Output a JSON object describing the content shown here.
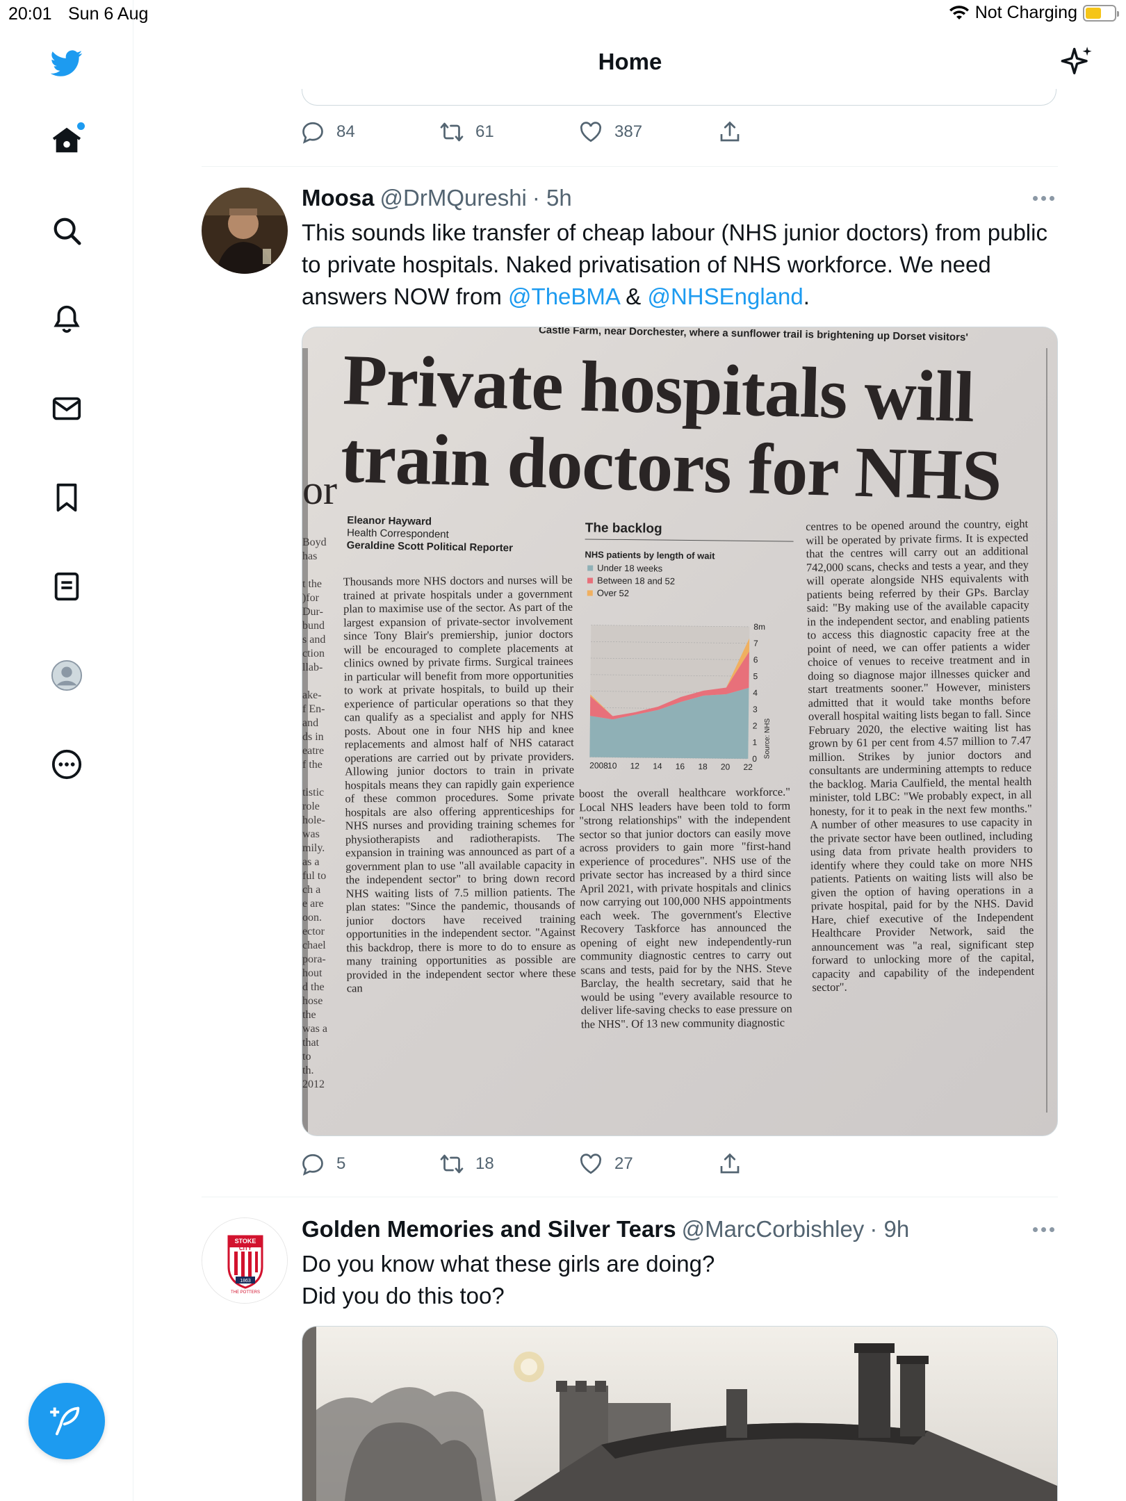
{
  "status_bar": {
    "time": "20:01",
    "date": "Sun 6 Aug",
    "charging": "Not Charging"
  },
  "header": {
    "title": "Home"
  },
  "nav": {
    "items": [
      "twitter-logo",
      "home",
      "search",
      "notifications",
      "messages",
      "bookmarks",
      "lists",
      "profile",
      "more"
    ],
    "accent_color": "#1d9bf0"
  },
  "prev_tweet": {
    "replies": "84",
    "retweets": "61",
    "likes": "387"
  },
  "tweets": [
    {
      "name": "Moosa",
      "handle": "@DrMQureshi",
      "time": "· 5h",
      "text_parts": [
        "This sounds like transfer of cheap labour (NHS junior doctors) from public to private hospitals. Naked privatisation of NHS workforce. We need answers NOW from ",
        "@TheBMA",
        " & ",
        "@NHSEngland",
        "."
      ],
      "media": {
        "kicker": "Castle Farm, near Dorchester, where a sunflower trail is brightening up Dorset visitors'",
        "headline": [
          "Private hospitals will",
          "train doctors for NHS"
        ],
        "byline": [
          "Eleanor Hayward",
          "Health Correspondent",
          "Geraldine Scott Political Reporter"
        ],
        "chart": {
          "title": "The backlog",
          "subtitle": "NHS patients by length of wait",
          "legend": [
            "Under 18 weeks",
            "Between 18 and 52",
            "Over 52"
          ],
          "source": "Source: NHS"
        },
        "col1": "Thousands more NHS doctors and nurses will be trained at private hospitals under a government plan to maximise use of the sector. As part of the largest expansion of private-sector involvement since Tony Blair's premiership, junior doctors will be encouraged to complete placements at clinics owned by private firms. Surgical trainees in particular will benefit from more opportunities to work at private hospitals, to build up their experience of particular operations so that they can qualify as a specialist and apply for NHS posts. About one in four NHS hip and knee replacements and almost half of NHS cataract operations are carried out by private providers. Allowing junior doctors to train in private hospitals means they can rapidly gain experience of these common procedures. Some private hospitals are also offering apprenticeships for NHS nurses and providing training schemes for physiotherapists and radiotherapists. The expansion in training was announced as part of a government plan to use \"all available capacity in the independent sector\" to bring down record NHS waiting lists of 7.5 million patients. The plan states: \"Since the pandemic, thousands of junior doctors have received training opportunities in the independent sector. \"Against this backdrop, there is more to do to ensure as many training opportunities as possible are provided in the independent sector where these can",
        "col2": "boost the overall healthcare workforce.\" Local NHS leaders have been told to form \"strong relationships\" with the independent sector so that junior doctors can easily move across providers to gain more \"first-hand experience of procedures\". NHS use of the private sector has increased by a third since April 2021, with private hospitals and clinics now carrying out 100,000 NHS appointments each week. The government's Elective Recovery Taskforce has announced the opening of eight new independently-run community diagnostic centres to carry out scans and tests, paid for by the NHS. Steve Barclay, the health secretary, said that he would be using \"every available resource to deliver life-saving checks to ease pressure on the NHS\". Of 13 new community diagnostic",
        "col3": "centres to be opened around the country, eight will be operated by private firms. It is expected that the centres will carry out an additional 742,000 scans, checks and tests a year, and they will operate alongside NHS equivalents with patients being referred by their GPs. Barclay said: \"By making use of the available capacity in the independent sector, and enabling patients to access this diagnostic capacity free at the point of need, we can offer patients a wider choice of venues to receive treatment and in doing so diagnose major illnesses quicker and start treatments sooner.\" However, ministers admitted that it would take months before overall hospital waiting lists began to fall. Since February 2020, the elective waiting list has grown by 61 per cent from 4.57 million to 7.47 million. Strikes by junior doctors and consultants are undermining attempts to reduce the backlog. Maria Caulfield, the mental health minister, told LBC: \"We probably expect, in all honesty, for it to peak in the next few months.\" A number of other measures to use capacity in the private sector have been outlined, including using data from private health providers to identify where they could take on more NHS patients. Patients on waiting lists will also be given the option of having operations in a private hospital, paid for by the NHS. David Hare, chief executive of the Independent Healthcare Provider Network, said the announcement was \"a real, significant step forward to unlocking more of the capital, capacity and capability of the independent sector\"."
      },
      "replies": "5",
      "retweets": "18",
      "likes": "27"
    },
    {
      "name": "Golden Memories and Silver Tears",
      "handle": "@MarcCorbishley",
      "time": "· 9h",
      "text_lines": [
        "Do you know what these girls are doing?",
        "Did you do this too?"
      ],
      "avatar_text": [
        "STOKE",
        "CITY",
        "1863",
        "THE POTTERS"
      ]
    }
  ],
  "chart_data": {
    "type": "area",
    "title": "The backlog",
    "subtitle": "NHS patients by length of wait",
    "x": [
      2008,
      2010,
      2012,
      2014,
      2016,
      2018,
      2020,
      2022
    ],
    "x_ticks": [
      "2008",
      "10",
      "12",
      "14",
      "16",
      "18",
      "20",
      "22"
    ],
    "y_ticks": [
      "0",
      "1",
      "2",
      "3",
      "4",
      "5",
      "6",
      "7",
      "8m"
    ],
    "ylim": [
      0,
      8
    ],
    "series": [
      {
        "name": "Under 18 weeks",
        "values": [
          2.5,
          2.3,
          2.6,
          2.9,
          3.4,
          3.8,
          3.9,
          4.3
        ],
        "color": "#8fb0b6"
      },
      {
        "name": "Between 18 and 52",
        "values": [
          1.2,
          0.2,
          0.15,
          0.2,
          0.3,
          0.3,
          0.4,
          2.2
        ],
        "color": "#e8707a"
      },
      {
        "name": "Over 52",
        "values": [
          0.1,
          0.0,
          0.0,
          0.0,
          0.0,
          0.0,
          0.0,
          0.8
        ],
        "color": "#f0b060"
      }
    ]
  }
}
